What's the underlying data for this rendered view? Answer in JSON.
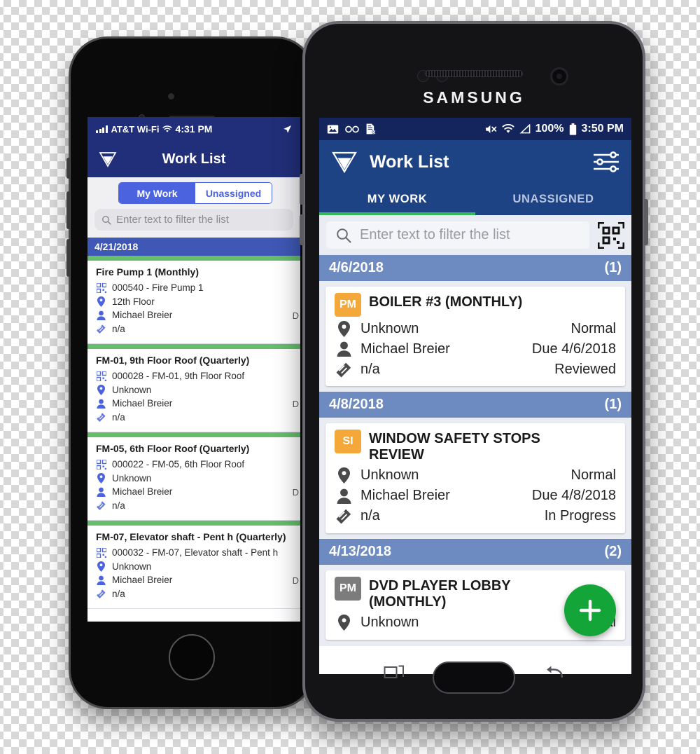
{
  "iphone": {
    "status_bar": {
      "carrier": "AT&T Wi-Fi",
      "time": "4:31 PM",
      "signal_icon": "cellular-bars-icon",
      "wifi_icon": "wifi-icon",
      "location_icon": "location-arrow-icon"
    },
    "navbar": {
      "logo_icon": "app-logo-icon",
      "title": "Work List"
    },
    "segmented": {
      "tabs": [
        {
          "label": "My Work",
          "selected": true
        },
        {
          "label": "Unassigned",
          "selected": false
        }
      ]
    },
    "search": {
      "placeholder": "Enter text to filter the list",
      "icon": "search-icon"
    },
    "date_band": "4/21/2018",
    "cards": [
      {
        "title": "Fire Pump 1 (Monthly)",
        "asset": "000540 - Fire Pump 1",
        "location": "12th Floor",
        "assignee": "Michael Breier",
        "attachment": "n/a",
        "cut_off_right": "D"
      },
      {
        "title": "FM-01, 9th Floor Roof (Quarterly)",
        "asset": "000028 - FM-01, 9th Floor Roof",
        "location": "Unknown",
        "assignee": "Michael Breier",
        "attachment": "n/a",
        "cut_off_right": "D"
      },
      {
        "title": "FM-05, 6th Floor Roof (Quarterly)",
        "asset": "000022 - FM-05, 6th Floor Roof",
        "location": "Unknown",
        "assignee": "Michael Breier",
        "attachment": "n/a",
        "cut_off_right": "D"
      },
      {
        "title": "FM-07, Elevator shaft - Pent h (Quarterly)",
        "asset": "000032 - FM-07, Elevator shaft - Pent h",
        "location": "Unknown",
        "assignee": "Michael Breier",
        "attachment": "n/a",
        "cut_off_right": "D"
      }
    ],
    "icons": {
      "asset": "qr-code-icon",
      "location": "map-pin-icon",
      "assignee": "person-icon",
      "attachment": "wrench-icon"
    }
  },
  "samsung": {
    "brand": "SAMSUNG",
    "status_bar": {
      "left_icons": [
        "photo-icon",
        "voicemail-icon",
        "document-x-icon"
      ],
      "mute_icon": "mute-icon",
      "wifi_icon": "wifi-icon",
      "signal_icon": "signal-triangle-icon",
      "battery_percent": "100%",
      "battery_icon": "battery-icon",
      "time": "3:50 PM"
    },
    "navbar": {
      "logo_icon": "app-logo-icon",
      "title": "Work List",
      "filter_icon": "sliders-icon"
    },
    "tabs": [
      {
        "label": "MY WORK",
        "selected": true
      },
      {
        "label": "UNASSIGNED",
        "selected": false
      }
    ],
    "search": {
      "placeholder": "Enter text to filter the list",
      "icon": "search-icon",
      "scan_icon": "qr-scan-icon"
    },
    "groups": [
      {
        "date": "4/6/2018",
        "count": "(1)",
        "cards": [
          {
            "badge": "PM",
            "badge_color": "#f4a83a",
            "title": "BOILER #3 (MONTHLY)",
            "location": "Unknown",
            "priority": "Normal",
            "assignee": "Michael Breier",
            "due": "Due 4/6/2018",
            "attachment": "n/a",
            "status": "Reviewed"
          }
        ]
      },
      {
        "date": "4/8/2018",
        "count": "(1)",
        "cards": [
          {
            "badge": "SI",
            "badge_color": "#f4a83a",
            "title": "WINDOW SAFETY STOPS REVIEW",
            "location": "Unknown",
            "priority": "Normal",
            "assignee": "Michael Breier",
            "due": "Due 4/8/2018",
            "attachment": "n/a",
            "status": "In Progress"
          }
        ]
      },
      {
        "date": "4/13/2018",
        "count": "(2)",
        "cards": [
          {
            "badge": "PM",
            "badge_color": "#7c7c7c",
            "title": "DVD PLAYER LOBBY (MONTHLY)",
            "location": "Unknown",
            "priority": "Normal",
            "assignee": "",
            "due": "",
            "attachment": "",
            "status": ""
          }
        ]
      }
    ],
    "fab": {
      "icon": "plus-icon"
    },
    "nav_buttons": {
      "recents_icon": "recents-icon",
      "home_button": "home-button",
      "back_icon": "back-arrow-icon"
    },
    "icons": {
      "location": "map-pin-icon",
      "assignee": "person-icon",
      "attachment": "wrench-icon"
    }
  },
  "colors": {
    "iphone_header": "#212f7a",
    "iphone_date_band": "#3f58b5",
    "iphone_segment": "#4c63e0",
    "samsung_header": "#1e4385",
    "samsung_status": "#13255c",
    "samsung_date_band": "#6d8bc0",
    "green_accent": "#66bd6a",
    "tab_underline": "#36b85a",
    "fab_green": "#13a538",
    "badge_orange": "#f4a83a",
    "badge_gray": "#7c7c7c"
  }
}
